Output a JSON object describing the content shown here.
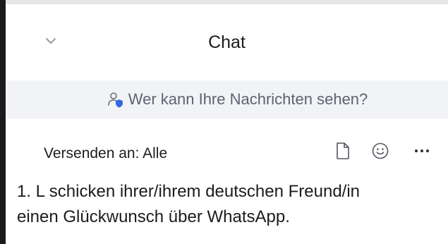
{
  "header": {
    "title": "Chat",
    "collapse_icon": "chevron-down-icon"
  },
  "privacy": {
    "icon": "person-shield-icon",
    "text": "Wer kann Ihre Nachrichten sehen?",
    "accent_color": "#2d6cdf"
  },
  "compose": {
    "send_to_label": "Versenden an: Alle",
    "tools": [
      {
        "name": "file-icon"
      },
      {
        "name": "emoji-icon"
      },
      {
        "name": "more-icon"
      }
    ],
    "message_line1": "1. L schicken ihrer/ihrem deutschen Freund/in",
    "message_line2": "einen Glückwunsch über WhatsApp."
  }
}
